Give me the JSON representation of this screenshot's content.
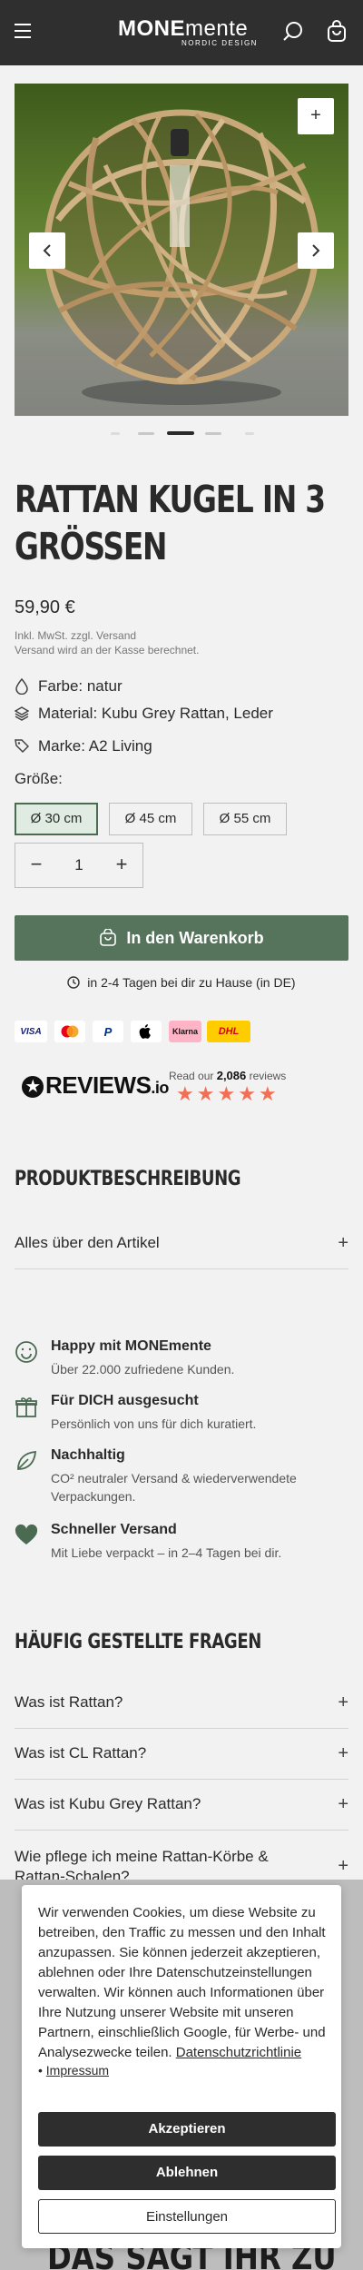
{
  "header": {
    "logo_main": "MONE",
    "logo_main_light": "mente",
    "logo_sub": "NORDIC DESIGN",
    "icons": [
      "menu-icon",
      "search-icon",
      "cart-icon"
    ]
  },
  "gallery": {
    "zoom_label": "+",
    "dot_count": 5,
    "active_dot": 2
  },
  "product": {
    "title_line1": "Rattan Kugel in 3",
    "title_line2": "Größen",
    "price": "59,90 €",
    "tax_line1": "Inkl. MwSt. zzgl. Versand",
    "tax_line2": "Versand wird an der Kasse berechnet.",
    "attributes": [
      {
        "icon": "drop-icon",
        "text": "Farbe: natur"
      },
      {
        "icon": "layers-icon",
        "text": "Material: Kubu Grey Rattan, Leder"
      },
      {
        "icon": "tag-icon",
        "text": "Marke: A2 Living"
      }
    ],
    "size_label": "Größe:",
    "sizes": [
      "Ø 30 cm",
      "Ø 45 cm",
      "Ø 55 cm"
    ],
    "selected_size": "Ø 30 cm",
    "quantity": "1",
    "cart_button": "In den Warenkorb",
    "delivery": "in 2-4 Tagen bei dir zu Hause (in DE)"
  },
  "payments": [
    {
      "name": "VISA",
      "bg": "#ffffff",
      "fg": "#1a1f71"
    },
    {
      "name": "",
      "bg": "#ffffff",
      "fg": "#eb001b"
    },
    {
      "name": "P",
      "bg": "#ffffff",
      "fg": "#003087"
    },
    {
      "name": "",
      "bg": "#ffffff",
      "fg": "#000000"
    },
    {
      "name": "Klarna",
      "bg": "#ffb3c7",
      "fg": "#17120f"
    },
    {
      "name": "DHL",
      "bg": "#ffcc00",
      "fg": "#d40511"
    }
  ],
  "reviews": {
    "logo": "REVIEWS",
    "logo_suffix": ".io",
    "prefix": "Read our",
    "count": "2,086",
    "suffix": "reviews",
    "rating": 5
  },
  "description": {
    "heading": "Produktbeschreibung",
    "row": "Alles über den Artikel",
    "plus": "+"
  },
  "usps": [
    {
      "icon": "smile-icon",
      "title": "Happy mit MONEmente",
      "desc": "Über 22.000 zufriedene Kunden."
    },
    {
      "icon": "gift-icon",
      "title": "Für DICH ausgesucht",
      "desc": "Persönlich von uns für dich kuratiert."
    },
    {
      "icon": "leaf-icon",
      "title": "Nachhaltig",
      "desc": "CO² neutraler Versand & wiederverwendete Verpackungen."
    },
    {
      "icon": "heart-icon",
      "title": "Schneller Versand",
      "desc": "Mit Liebe verpackt – in 2–4 Tagen bei dir."
    }
  ],
  "faq": {
    "heading": "Häufig gestellte Fragen",
    "items": [
      "Was ist Rattan?",
      "Was ist CL Rattan?",
      "Was ist Kubu Grey Rattan?",
      "Wie pflege ich meine Rattan-Körbe & Rattan-Schalen?"
    ],
    "plus": "+"
  },
  "cookie": {
    "text": "Wir verwenden Cookies, um diese Website zu betreiben, den Traffic zu messen und den Inhalt anzupassen. Sie können jederzeit akzeptieren, ablehnen oder Ihre Datenschutzeinstellungen verwalten. Wir können auch Informationen über Ihre Nutzung unserer Website mit unseren Partnern, einschließlich Google, für Werbe- und Analysezwecke teilen.",
    "policy_link": "Datenschutzrichtlinie",
    "impressum": "Impressum",
    "accept": "Akzeptieren",
    "reject": "Ablehnen",
    "settings": "Einstellungen"
  },
  "bottom_heading": "Das sagt ihr zu"
}
